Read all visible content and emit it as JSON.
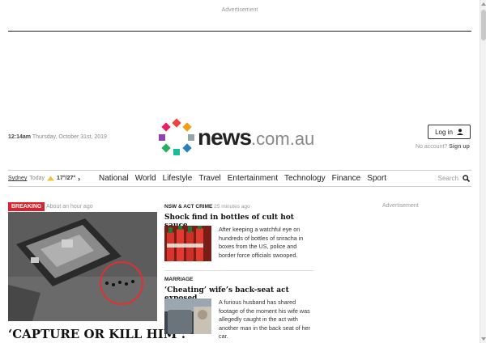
{
  "ads": {
    "top_label": "Advertisement",
    "side_label": "Advertisement"
  },
  "header": {
    "time": "12:14am",
    "date": "Thursday, October 31st, 2019",
    "logo_main": "news",
    "logo_suffix": ".com.au",
    "login_label": "Log in",
    "account_prompt": "No account?",
    "signup_label": "Sign up"
  },
  "weather": {
    "city": "Sydney",
    "day": "Today",
    "temps": "17°/27°",
    "icon": "partly-sunny-icon"
  },
  "nav": {
    "links": [
      "National",
      "World",
      "Lifestyle",
      "Travel",
      "Entertainment",
      "Technology",
      "Finance",
      "Sport"
    ],
    "search_label": "Search"
  },
  "lead": {
    "badge": "BREAKING",
    "time": "About an hour ago",
    "headline": "‘CAPTURE OR KILL HIM’:"
  },
  "stories": [
    {
      "section": "NSW & ACT CRIME",
      "time": "25 minutes ago",
      "headline": "Shock find in bottles of cult hot sauce",
      "blurb": "After keeping a watchful eye on hundreds of bottles of sriracha in boxes from the US, police and border force officials swooped."
    },
    {
      "section": "MARRIAGE",
      "time": "",
      "headline": "‘Cheating’ wife’s back-seat act exposed",
      "blurb": "A furious husband has shared footage of the moment his wife was allegedly caught in the act with another man in the back seat of her car."
    }
  ],
  "colors": {
    "breaking": "#d9232d",
    "text": "#222222",
    "muted": "#999999"
  }
}
